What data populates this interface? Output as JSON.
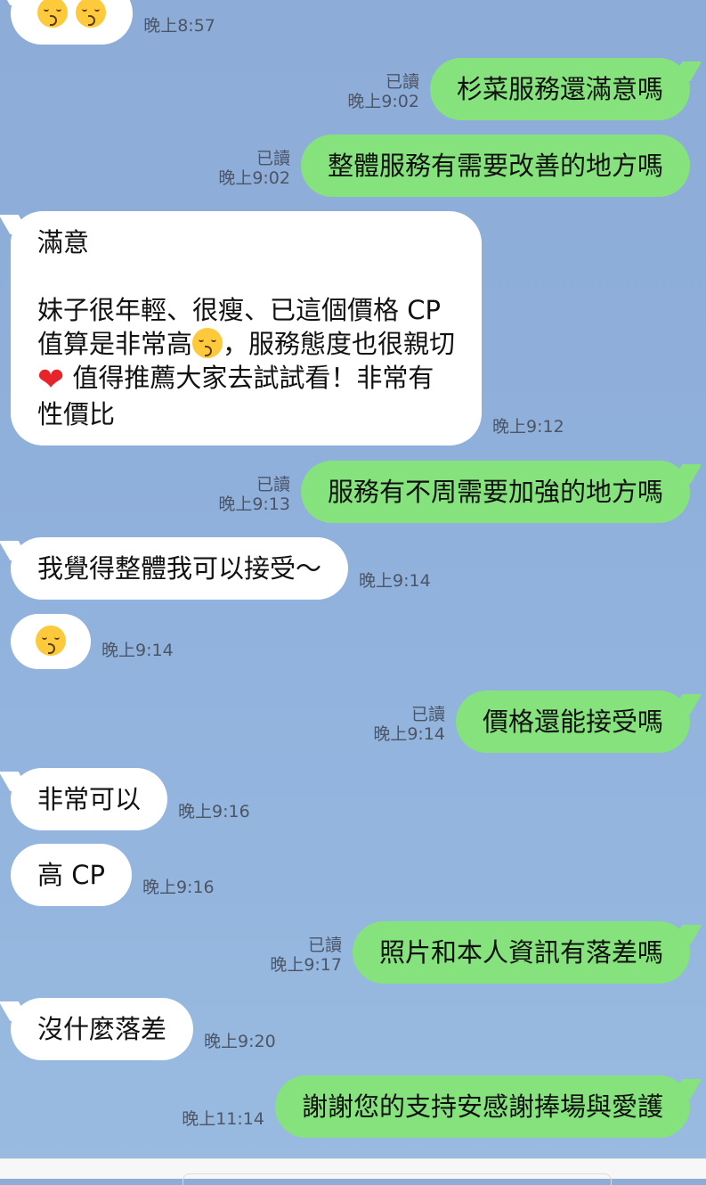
{
  "messages": [
    {
      "side": "in",
      "parts": [
        {
          "e": "kiss"
        },
        {
          "t": " "
        },
        {
          "e": "kiss"
        }
      ],
      "time": "晚上8:57"
    },
    {
      "side": "out",
      "parts": [
        {
          "t": "杉菜服務還滿意嗎"
        }
      ],
      "read": "已讀",
      "time": "晚上9:02"
    },
    {
      "side": "out",
      "parts": [
        {
          "t": "整體服務有需要改善的地方嗎"
        }
      ],
      "read": "已讀",
      "time": "晚上9:02"
    },
    {
      "side": "in",
      "parts": [
        {
          "t": "滿意\n\n妹子很年輕、很瘦、已這個價格 CP\n值算是非常高"
        },
        {
          "e": "kiss"
        },
        {
          "t": "，服務態度也很親切\n"
        },
        {
          "e": "heart"
        },
        {
          "t": " 值得推薦大家去試試看！非常有\n性價比"
        }
      ],
      "time": "晚上9:12"
    },
    {
      "side": "out",
      "parts": [
        {
          "t": "服務有不周需要加強的地方嗎"
        }
      ],
      "read": "已讀",
      "time": "晚上9:13"
    },
    {
      "side": "in",
      "parts": [
        {
          "t": "我覺得整體我可以接受～"
        }
      ],
      "time": "晚上9:14"
    },
    {
      "side": "in",
      "parts": [
        {
          "e": "kiss"
        }
      ],
      "time": "晚上9:14"
    },
    {
      "side": "out",
      "parts": [
        {
          "t": "價格還能接受嗎"
        }
      ],
      "read": "已讀",
      "time": "晚上9:14"
    },
    {
      "side": "in",
      "parts": [
        {
          "t": "非常可以"
        }
      ],
      "time": "晚上9:16"
    },
    {
      "side": "in",
      "parts": [
        {
          "t": "高 CP"
        }
      ],
      "time": "晚上9:16"
    },
    {
      "side": "out",
      "parts": [
        {
          "t": "照片和本人資訊有落差嗎"
        }
      ],
      "read": "已讀",
      "time": "晚上9:17"
    },
    {
      "side": "in",
      "parts": [
        {
          "t": "沒什麼落差"
        }
      ],
      "time": "晚上9:20"
    },
    {
      "side": "out",
      "parts": [
        {
          "t": "謝謝您的支持安感謝捧場與愛護"
        }
      ],
      "time": "晚上11:14"
    }
  ],
  "colors": {
    "background": "#8fb0db",
    "outgoing_bubble": "#85e27c",
    "incoming_bubble": "#ffffff",
    "meta_text": "#4c5565"
  },
  "icons": {
    "kiss": "kissing-face-emoji",
    "heart": "red-heart-emoji"
  }
}
